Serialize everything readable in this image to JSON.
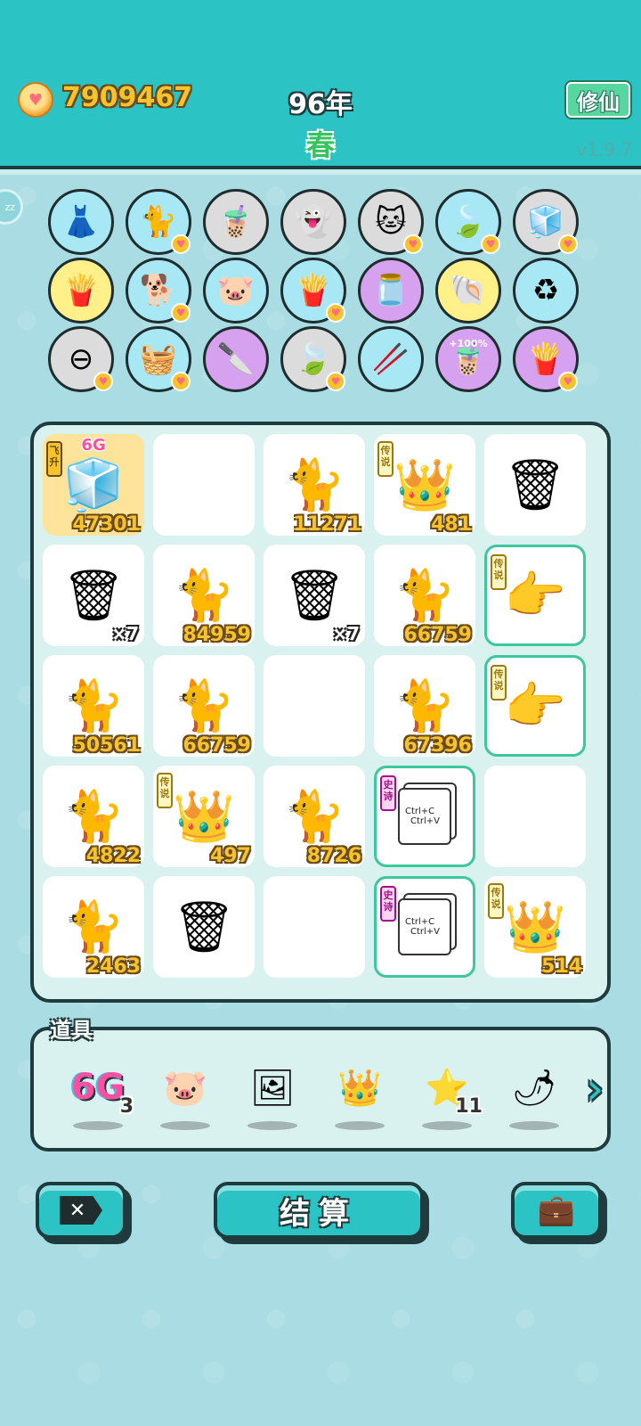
{
  "header": {
    "coins": "7909467",
    "year": "96年",
    "season": "春",
    "xiuxian_label": "修仙",
    "version": "v1.9.7",
    "zz_label": "zz"
  },
  "collection": {
    "items": [
      {
        "icon": "skirt-icon",
        "glyph": "👗",
        "bg": "#a8e8f4",
        "heart": false
      },
      {
        "icon": "cat-icon",
        "glyph": "🐈",
        "bg": "#a8e8f4",
        "heart": true
      },
      {
        "icon": "boba-tea-icon",
        "glyph": "🧋",
        "bg": "#dcdcdc",
        "heart": false
      },
      {
        "icon": "ghost-icon",
        "glyph": "👻",
        "bg": "#dcdcdc",
        "heart": false
      },
      {
        "icon": "cat-pair-icon",
        "glyph": "🐱",
        "bg": "#dcdcdc",
        "heart": true
      },
      {
        "icon": "leaf-icon",
        "glyph": "🍃",
        "bg": "#a8e8f4",
        "heart": true
      },
      {
        "icon": "sugar-cubes-icon",
        "glyph": "🧊",
        "bg": "#dcdcdc",
        "heart": true
      },
      {
        "icon": "fries-icon",
        "glyph": "🍟",
        "bg": "#fff08a",
        "heart": false
      },
      {
        "icon": "husky-icon",
        "glyph": "🐕",
        "bg": "#a8e8f4",
        "heart": true
      },
      {
        "icon": "piggy-bank-icon",
        "glyph": "🐷",
        "bg": "#a8e8f4",
        "heart": false
      },
      {
        "icon": "fries-icon",
        "glyph": "🍟",
        "bg": "#a8e8f4",
        "heart": true
      },
      {
        "icon": "jar-icon",
        "glyph": "🫙",
        "bg": "#d6a2f0",
        "heart": false
      },
      {
        "icon": "shell-icon",
        "glyph": "🐚",
        "bg": "#fff08a",
        "heart": false
      },
      {
        "icon": "recycle-bag-icon",
        "glyph": "♻",
        "bg": "#a8e8f4",
        "heart": false
      },
      {
        "icon": "minus-icon",
        "glyph": "⊖",
        "bg": "#dcdcdc",
        "heart": true
      },
      {
        "icon": "basket-icon",
        "glyph": "🧺",
        "bg": "#a8e8f4",
        "heart": true
      },
      {
        "icon": "cleaver-icon",
        "glyph": "🔪",
        "bg": "#d6a2f0",
        "heart": false
      },
      {
        "icon": "leaf-icon",
        "glyph": "🍃",
        "bg": "#dcdcdc",
        "heart": true
      },
      {
        "icon": "chopsticks-icon",
        "glyph": "🥢",
        "bg": "#a8e8f4",
        "heart": false
      },
      {
        "icon": "boba-plus-icon",
        "glyph": "🧋",
        "bg": "#d6a2f0",
        "heart": false,
        "badge": "+100%"
      },
      {
        "icon": "fries-icon",
        "glyph": "🍟",
        "bg": "#d6a2f0",
        "heart": true
      }
    ]
  },
  "board": {
    "cells": [
      {
        "kind": "fridge",
        "glyph": "🧊",
        "count": "47301",
        "gold": true,
        "tag": "飞升",
        "tagtype": "fly",
        "toplabel": "6G"
      },
      {
        "kind": "empty"
      },
      {
        "kind": "cat",
        "glyph": "🐈",
        "count": "11271"
      },
      {
        "kind": "king",
        "glyph": "👑",
        "count": "481",
        "tag": "传说",
        "tagtype": "legend"
      },
      {
        "kind": "bag",
        "glyph": "🗑"
      },
      {
        "kind": "bag",
        "glyph": "🗑",
        "mult": "×7"
      },
      {
        "kind": "cat",
        "glyph": "🐈",
        "count": "84959"
      },
      {
        "kind": "bag",
        "glyph": "🗑",
        "mult": "×7"
      },
      {
        "kind": "cat",
        "glyph": "🐈",
        "count": "66759"
      },
      {
        "kind": "hand",
        "glyph": "👉",
        "legend": true,
        "tag": "传说",
        "tagtype": "legend"
      },
      {
        "kind": "cat",
        "glyph": "🐈",
        "count": "50561"
      },
      {
        "kind": "cat",
        "glyph": "🐈",
        "count": "66759"
      },
      {
        "kind": "empty"
      },
      {
        "kind": "cat",
        "glyph": "🐈",
        "count": "67396"
      },
      {
        "kind": "hand-crown",
        "glyph": "👉",
        "legend": true,
        "tag": "传说",
        "tagtype": "legend"
      },
      {
        "kind": "cat",
        "glyph": "🐈",
        "count": "4822"
      },
      {
        "kind": "king",
        "glyph": "👑",
        "count": "497",
        "tag": "传说",
        "tagtype": "legend"
      },
      {
        "kind": "cat",
        "glyph": "🐈",
        "count": "8726"
      },
      {
        "kind": "ctrl",
        "legend": true,
        "tag": "史诗",
        "tagtype": "epic",
        "ctrl_c": "Ctrl+C",
        "ctrl_v": "Ctrl+V"
      },
      {
        "kind": "empty"
      },
      {
        "kind": "cat",
        "glyph": "🐈",
        "count": "2463"
      },
      {
        "kind": "bag",
        "glyph": "🗑"
      },
      {
        "kind": "empty"
      },
      {
        "kind": "ctrl",
        "legend": true,
        "tag": "史诗",
        "tagtype": "epic",
        "ctrl_c": "Ctrl+C",
        "ctrl_v": "Ctrl+V"
      },
      {
        "kind": "king",
        "glyph": "👑",
        "count": "514",
        "tag": "传说",
        "tagtype": "legend"
      }
    ]
  },
  "props": {
    "label": "道具",
    "items": [
      {
        "icon": "6g-icon",
        "text": "6G",
        "count": "3"
      },
      {
        "icon": "piggy-bank-icon",
        "glyph": "🐷"
      },
      {
        "icon": "cat-frame-icon",
        "glyph": "🖼"
      },
      {
        "icon": "crown-icon",
        "glyph": "👑"
      },
      {
        "icon": "star-icon",
        "glyph": "⭐",
        "count": "11"
      },
      {
        "icon": "chili-icon",
        "glyph": "🌶"
      }
    ]
  },
  "buttons": {
    "settle_label": "结算",
    "close_label": "✕",
    "bag_glyph": "💼"
  }
}
